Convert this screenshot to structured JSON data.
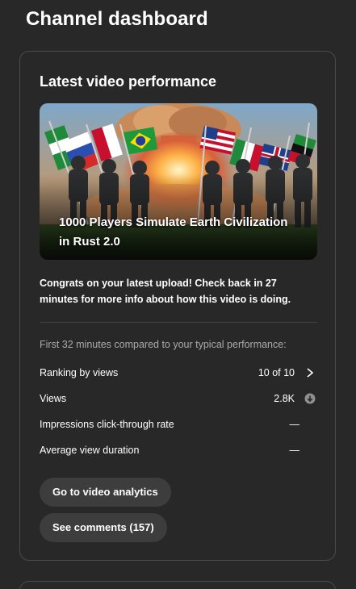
{
  "page": {
    "title": "Channel dashboard"
  },
  "card": {
    "title": "Latest video performance",
    "video": {
      "title": "1000 Players Simulate Earth Civilization in Rust 2.0"
    },
    "congrats_text": "Congrats on your latest upload! Check back in 27 minutes for more info about how this video is doing.",
    "compare_label": "First 32 minutes compared to your typical performance:",
    "metrics": [
      {
        "label": "Ranking by views",
        "value": "10 of 10",
        "icon": "chevron-right-icon"
      },
      {
        "label": "Views",
        "value": "2.8K",
        "icon": "arrow-down-circle-icon"
      },
      {
        "label": "Impressions click-through rate",
        "value": "—"
      },
      {
        "label": "Average view duration",
        "value": "—"
      }
    ],
    "buttons": {
      "analytics": "Go to video analytics",
      "comments": "See comments (157)"
    }
  },
  "colors": {
    "background": "#282828",
    "card_border": "#4a4a4a",
    "button_bg": "#3d3d3d",
    "muted_text": "#aaaaaa"
  }
}
